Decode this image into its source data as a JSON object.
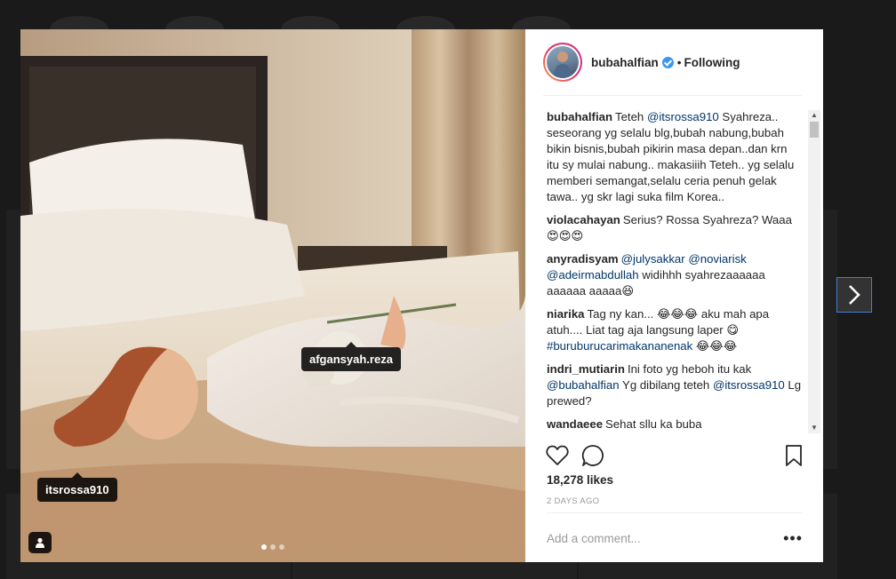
{
  "post": {
    "username": "bubahalfian",
    "follow_status": "Following",
    "follow_separator": "•",
    "photo_tags": [
      "afgansyah.reza",
      "itsrossa910"
    ],
    "carousel": {
      "count": 3,
      "active_index": 0
    }
  },
  "comments": [
    {
      "user": "bubahalfian",
      "parts": [
        {
          "t": "text",
          "v": "Teteh "
        },
        {
          "t": "mention",
          "v": "@itsrossa910"
        },
        {
          "t": "text",
          "v": " Syahreza.. seseorang yg selalu blg,bubah nabung,bubah bikin bisnis,bubah pikirin masa depan..dan krn itu sy mulai nabung.. makasiiih Teteh.. yg selalu memberi semangat,selalu ceria penuh gelak tawa.. yg skr lagi suka film Korea.."
        }
      ]
    },
    {
      "user": "violacahayan",
      "parts": [
        {
          "t": "text",
          "v": "Serius? Rossa Syahreza? Waaa😍😍😍"
        }
      ]
    },
    {
      "user": "anyradisyam",
      "parts": [
        {
          "t": "mention",
          "v": "@julysakkar"
        },
        {
          "t": "text",
          "v": " "
        },
        {
          "t": "mention",
          "v": "@noviarisk"
        },
        {
          "t": "text",
          "v": " "
        },
        {
          "t": "mention",
          "v": "@adeirmabdullah"
        },
        {
          "t": "text",
          "v": " widihhh syahrezaaaaaa aaaaaa aaaaa😆"
        }
      ]
    },
    {
      "user": "niarika",
      "parts": [
        {
          "t": "text",
          "v": "Tag ny kan... 😂😂😂 aku mah apa atuh.... Liat tag aja langsung laper 😋 "
        },
        {
          "t": "mention",
          "v": "#buruburucarimakananenak"
        },
        {
          "t": "text",
          "v": " 😂😂😂"
        }
      ]
    },
    {
      "user": "indri_mutiarin",
      "parts": [
        {
          "t": "text",
          "v": "Ini foto yg heboh itu kak "
        },
        {
          "t": "mention",
          "v": "@bubahalfian"
        },
        {
          "t": "text",
          "v": " Yg dibilang teteh "
        },
        {
          "t": "mention",
          "v": "@itsrossa910"
        },
        {
          "t": "text",
          "v": " Lg prewed?"
        }
      ]
    },
    {
      "user": "wandaeee",
      "parts": [
        {
          "t": "text",
          "v": "Sehat sllu ka buba"
        }
      ]
    }
  ],
  "likes": "18,278 likes",
  "date": "2 DAYS AGO",
  "add_comment": {
    "placeholder": "Add a comment..."
  },
  "more_options": "•••",
  "icons": {
    "like": "heart-outline-icon",
    "comment": "speech-bubble-icon",
    "save": "bookmark-icon",
    "next": "chevron-right-icon",
    "tag": "user-tag-icon",
    "verified": "verified-badge-icon"
  },
  "colors": {
    "mention": "#003569",
    "verified": "#3897f0",
    "scroll_up": "▲",
    "scroll_down": "▼"
  }
}
